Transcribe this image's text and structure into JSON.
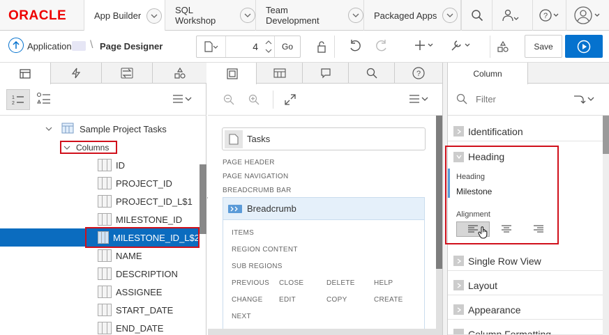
{
  "header": {
    "logo": "ORACLE",
    "tabs": [
      "App Builder",
      "SQL Workshop",
      "Team Development",
      "Packaged Apps"
    ]
  },
  "toolbar": {
    "application_label": "Application",
    "page_designer_label": "Page Designer",
    "page_number": "4",
    "go_label": "Go",
    "save_label": "Save"
  },
  "left": {
    "tree": {
      "region": "Sample Project Tasks",
      "columns_node": "Columns",
      "items": [
        "ID",
        "PROJECT_ID",
        "PROJECT_ID_L$1",
        "MILESTONE_ID",
        "MILESTONE_ID_L$2",
        "NAME",
        "DESCRIPTION",
        "ASSIGNEE",
        "START_DATE",
        "END_DATE"
      ],
      "selected": "MILESTONE_ID_L$2"
    }
  },
  "center": {
    "page_title": "Tasks",
    "positions": [
      "PAGE HEADER",
      "PAGE NAVIGATION",
      "BREADCRUMB BAR"
    ],
    "breadcrumb": "Breadcrumb",
    "slots": [
      "ITEMS",
      "REGION CONTENT",
      "SUB REGIONS"
    ],
    "buttons_row1": [
      "PREVIOUS",
      "CLOSE",
      "DELETE",
      "HELP"
    ],
    "buttons_row2": [
      "CHANGE",
      "EDIT",
      "COPY",
      "CREATE"
    ],
    "next": "NEXT"
  },
  "right": {
    "tab": "Column",
    "filter_placeholder": "Filter",
    "sections": {
      "identification": "Identification",
      "heading": "Heading",
      "single_row_view": "Single Row View",
      "layout": "Layout",
      "appearance": "Appearance",
      "column_formatting": "Column Formatting"
    },
    "heading_label": "Heading",
    "heading_value": "Milestone",
    "alignment_label": "Alignment"
  },
  "colors": {
    "accent": "#0572ce",
    "selected_row": "#0b6cbf",
    "highlight_box": "#d0101b",
    "oracle_red": "#e00000"
  }
}
